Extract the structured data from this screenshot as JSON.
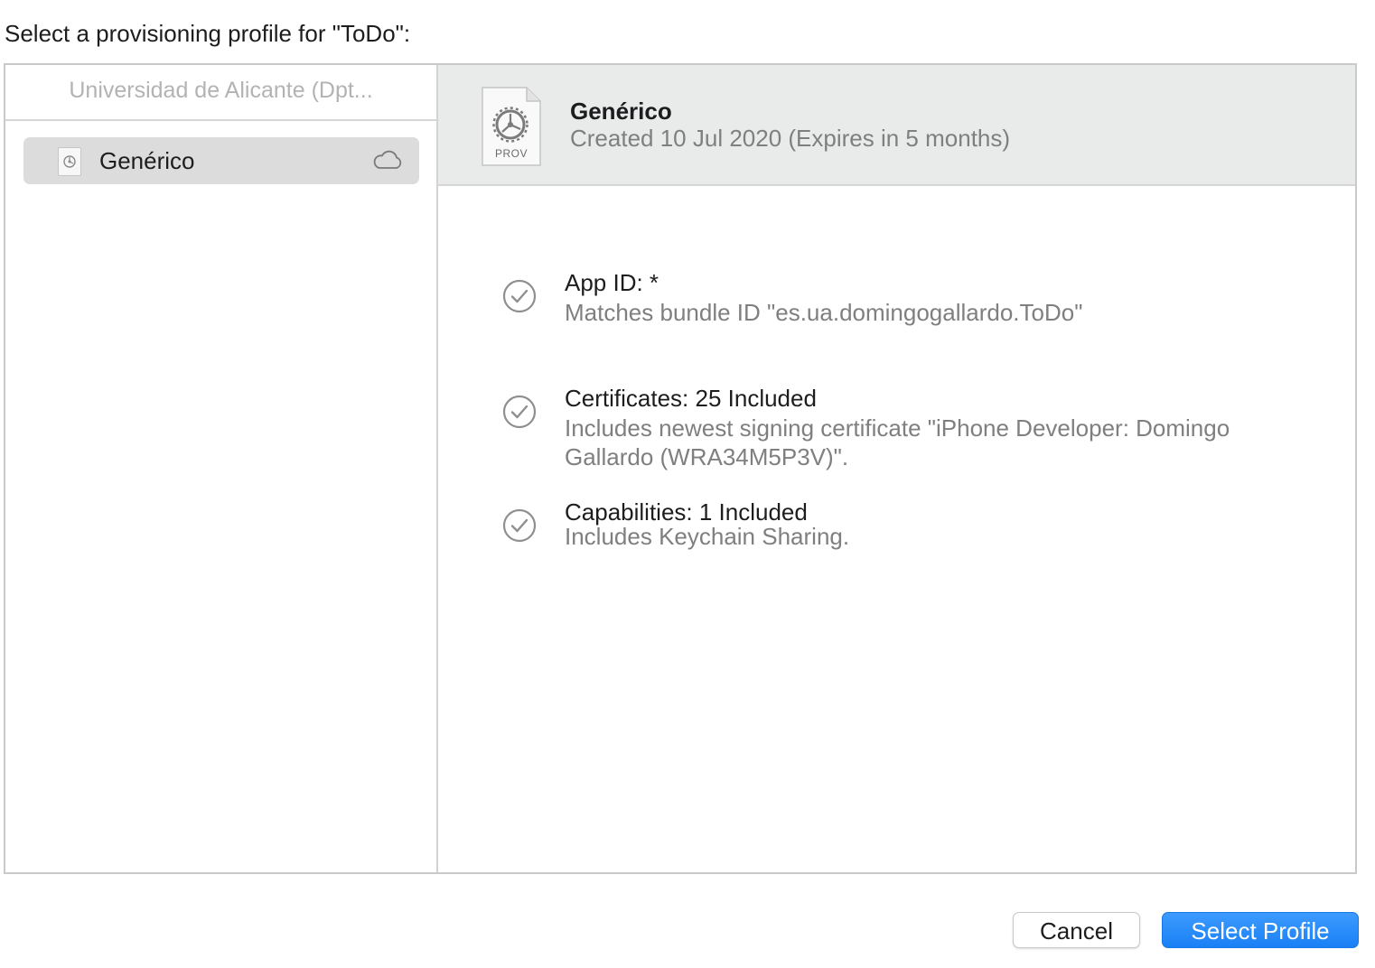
{
  "dialog": {
    "prompt": "Select a provisioning profile for \"ToDo\":"
  },
  "sidebar": {
    "team_header": "Universidad de Alicante (Dpt...",
    "profiles": [
      {
        "label": "Genérico",
        "icon": "cloud-icon",
        "selected": true
      }
    ]
  },
  "detail": {
    "file_icon_label": "PROV",
    "name": "Genérico",
    "created": "Created 10 Jul 2020 (Expires in 5 months)",
    "items": [
      {
        "title": "App ID: *",
        "detail": "Matches bundle ID \"es.ua.domingogallardo.ToDo\"",
        "status": "checkmark-icon"
      },
      {
        "title": "Certificates: 25 Included",
        "detail": "Includes newest signing certificate \"iPhone Developer: Domingo Gallardo (WRA34M5P3V)\".",
        "status": "checkmark-icon"
      },
      {
        "title": "Capabilities: 1 Included",
        "detail": "Includes Keychain Sharing.",
        "status": "checkmark-icon"
      }
    ]
  },
  "buttons": {
    "cancel": "Cancel",
    "select": "Select Profile"
  },
  "colors": {
    "accent": "#1a80f5",
    "selection": "#dcdcdc",
    "header_bg": "#e9eaea"
  }
}
